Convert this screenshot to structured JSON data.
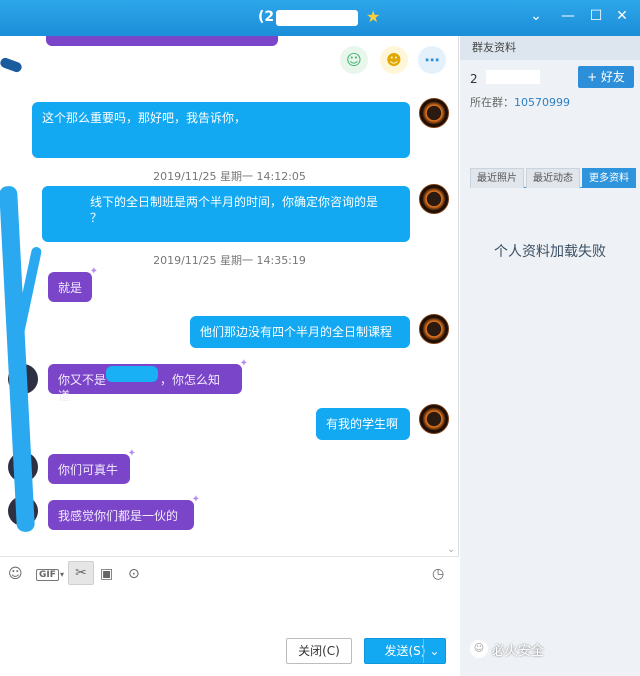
{
  "window": {
    "title": "(2",
    "controls": [
      "chevron-down-icon",
      "minimize-icon",
      "maximize-icon",
      "close-icon"
    ]
  },
  "chat": {
    "messages": [
      {
        "side": "me",
        "text": "这个那么重要吗，那好吧，我告诉你，"
      },
      {
        "kind": "time",
        "text": "2019/11/25 星期一 14:12:05"
      },
      {
        "side": "me",
        "text": "线下的全日制班是两个半月的时间，你确定你咨询的是",
        "text2": "？"
      },
      {
        "kind": "time",
        "text": "2019/11/25 星期一 14:35:19"
      },
      {
        "side": "them",
        "text": "就是"
      },
      {
        "side": "me",
        "text": "他们那边没有四个半月的全日制课程"
      },
      {
        "side": "them",
        "text": "你又不是",
        "text2": "，你怎么知道"
      },
      {
        "side": "me",
        "text": "有我的学生啊"
      },
      {
        "side": "them",
        "text": "你们可真牛"
      },
      {
        "side": "them",
        "text": "我感觉你们都是一伙的"
      }
    ]
  },
  "toolbar": {
    "gif_label": "GIF"
  },
  "buttons": {
    "close": "关闭(C)",
    "send": "发送(S)"
  },
  "side": {
    "header": "群友资料",
    "friend_prefix": "2",
    "add_friend": "+ 好友",
    "group_label": "所在群：",
    "group_number": "10570999",
    "tabs": [
      "最近照片",
      "最近动态",
      "更多资料"
    ],
    "load_failed": "个人资料加载失败"
  },
  "watermark": "必火安全",
  "colors": {
    "accent": "#1b8ed8",
    "bubble_me": "#12a8f2",
    "bubble_them": "#7a45c9"
  }
}
